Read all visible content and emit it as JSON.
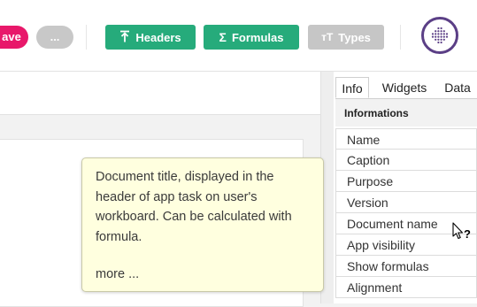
{
  "toolbar": {
    "save_label": "ave",
    "more_label": "...",
    "headers": {
      "icon": "upload-bar-icon",
      "label": "Headers"
    },
    "formulas": {
      "icon": "sigma-icon",
      "label": "Formulas"
    },
    "types": {
      "icon": "text-type-icon",
      "label": "Types"
    },
    "logo_icon": "dot-grid-logo"
  },
  "colors": {
    "save": "#e8186a",
    "green": "#26ab7b",
    "disabled": "#c6c6c6",
    "logo_ring": "#5b3f86",
    "tooltip_bg": "#ffffdf"
  },
  "panel": {
    "tabs": [
      "Info",
      "Widgets",
      "Data"
    ],
    "active_tab": "Info",
    "section_title": "Informations",
    "properties": [
      "Name",
      "Caption",
      "Purpose",
      "Version",
      "Document name",
      "App visibility",
      "Show formulas",
      "Alignment"
    ]
  },
  "tooltip": {
    "text": "Document title, displayed in the header of app task on user's workboard. Can be calculated with formula.",
    "more": "more ..."
  },
  "cursor": {
    "icon": "help-cursor-icon"
  }
}
